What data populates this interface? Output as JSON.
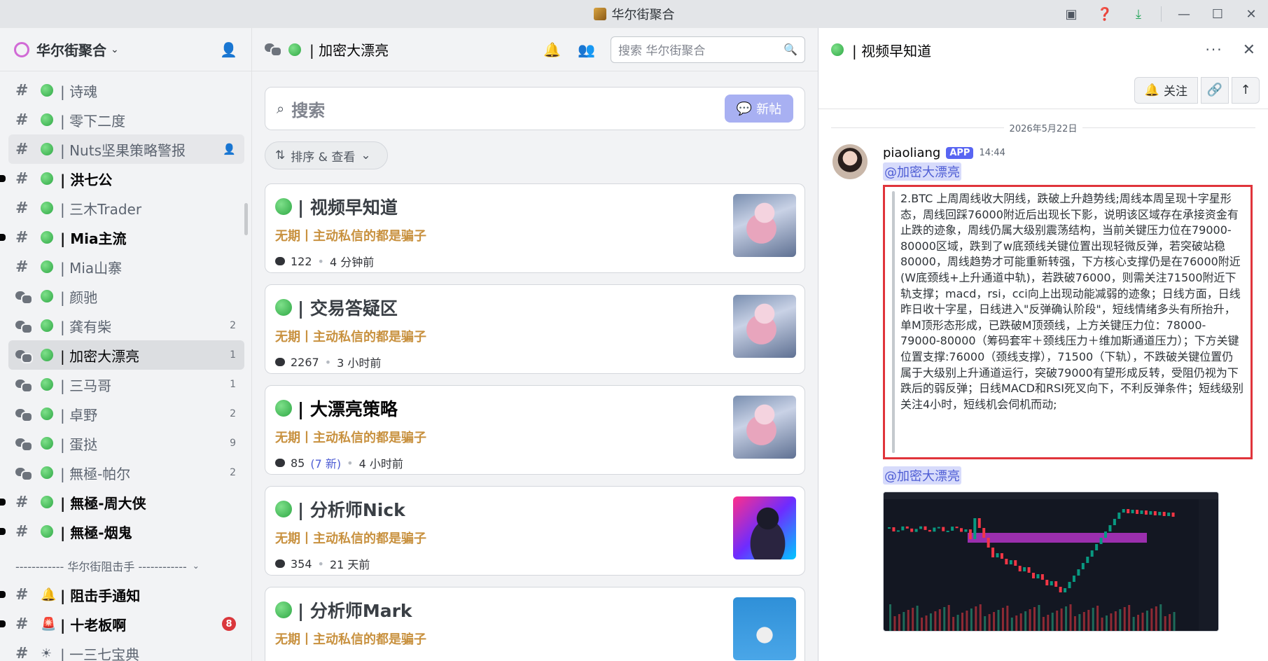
{
  "window": {
    "title": "华尔街聚合",
    "controls": [
      "inbox-icon",
      "help-icon",
      "download-icon",
      "minimize-icon",
      "maximize-icon",
      "close-icon"
    ]
  },
  "sidebar": {
    "server_name": "华尔街聚合",
    "channels": [
      {
        "type": "text",
        "name": "| 诗魂",
        "unread": false
      },
      {
        "type": "text",
        "name": "| 零下二度",
        "unread": false
      },
      {
        "type": "text",
        "name": "| Nuts坚果策略警报",
        "unread": false,
        "hover": true
      },
      {
        "type": "text",
        "name": "| 洪七公",
        "unread": true
      },
      {
        "type": "text",
        "name": "| 三木Trader",
        "unread": false
      },
      {
        "type": "text",
        "name": "| Mia主流",
        "unread": true
      },
      {
        "type": "text",
        "name": "| Mia山寨",
        "unread": false
      },
      {
        "type": "forum",
        "name": "| 颜驰",
        "unread": false
      },
      {
        "type": "forum",
        "name": "| 龚有柴",
        "count": "2"
      },
      {
        "type": "forum",
        "name": "| 加密大漂亮",
        "count": "1",
        "active": true
      },
      {
        "type": "forum",
        "name": "| 三马哥",
        "count": "1"
      },
      {
        "type": "forum",
        "name": "| 卓野",
        "count": "2"
      },
      {
        "type": "forum",
        "name": "| 蛋挞",
        "count": "9"
      },
      {
        "type": "forum",
        "name": "| 無極-帕尔",
        "count": "2"
      },
      {
        "type": "text",
        "name": "| 無極-周大侠",
        "unread": true
      },
      {
        "type": "text",
        "name": "| 無極-烟鬼",
        "unread": true
      }
    ],
    "category": "------------ 华尔街阻击手 ------------",
    "category_channels": [
      {
        "type": "text",
        "emoji": "🔔",
        "name": "| 阻击手通知",
        "unread": true
      },
      {
        "type": "text",
        "emoji": "🚨",
        "name": "| 十老板啊",
        "unread": true,
        "badge": "8"
      },
      {
        "type": "text",
        "emoji": "☀",
        "name": "| 一三七宝典",
        "unread": false
      }
    ]
  },
  "forum": {
    "title": "| 加密大漂亮",
    "search_placeholder": "搜索 华尔街聚合",
    "search_label": "搜索",
    "new_post_label": "新帖",
    "sort_label": "排序 & 查看",
    "posts": [
      {
        "title": "| 视频早知道",
        "subtitle": "无期丨主动私信的都是骗子",
        "replies": "122",
        "new": "",
        "time": "4 分钟前",
        "thumb": "anime",
        "highlight": false
      },
      {
        "title": "| 交易答疑区",
        "subtitle": "无期丨主动私信的都是骗子",
        "replies": "2267",
        "new": "",
        "time": "3 小时前",
        "thumb": "anime",
        "highlight": false
      },
      {
        "title": "| 大漂亮策略",
        "subtitle": "无期丨主动私信的都是骗子",
        "replies": "85",
        "new": "(7 新)",
        "time": "4 小时前",
        "thumb": "anime",
        "highlight": true
      },
      {
        "title": "| 分析师Nick",
        "subtitle": "无期丨主动私信的都是骗子",
        "replies": "354",
        "new": "",
        "time": "21 天前",
        "thumb": "neon",
        "highlight": false
      },
      {
        "title": "| 分析师Mark",
        "subtitle": "无期丨主动私信的都是骗子",
        "replies": "",
        "new": "",
        "time": "",
        "thumb": "skull",
        "highlight": false
      }
    ]
  },
  "thread": {
    "title": "| 视频早知道",
    "follow_label": "关注",
    "date": "2026年5月22日",
    "message": {
      "user": "piaoliang",
      "tag": "APP",
      "time": "14:44",
      "mention": "@加密大漂亮",
      "body": "2.BTC 上周周线收大阴线，跌破上升趋势线;周线本周呈现十字星形态，周线回踩76000附近后出现长下影，说明该区域存在承接资金有止跌的迹象，周线仍属大级别震荡结构，当前关键压力位在79000-80000区域，跌到了w底颈线关键位置出现轻微反弹，若突破站稳80000，周线趋势才可能重新转强，下方核心支撑仍是在76000附近(W底颈线+上升通道中轨)，若跌破76000，则需关注71500附近下轨支撑；macd，rsi，cci向上出现动能减弱的迹象；日线方面，日线昨日收十字星，日线进入\"反弹确认阶段\"，短线情绪多头有所抬升，单M顶形态形成，已跌破M顶颈线，上方关键压力位：78000-79000-80000（筹码套牢＋颈线压力＋维加斯通道压力）；下方关键位置支撑:76000（颈线支撑），71500（下轨），不跌破关键位置仍属于大级别上升通道运行，突破79000有望形成反转，受阻仍视为下跌后的弱反弹；日线MACD和RSI死叉向下，不利反弹条件；短线级别关注4小时，短线机会伺机而动;",
      "mention2": "@加密大漂亮"
    }
  }
}
